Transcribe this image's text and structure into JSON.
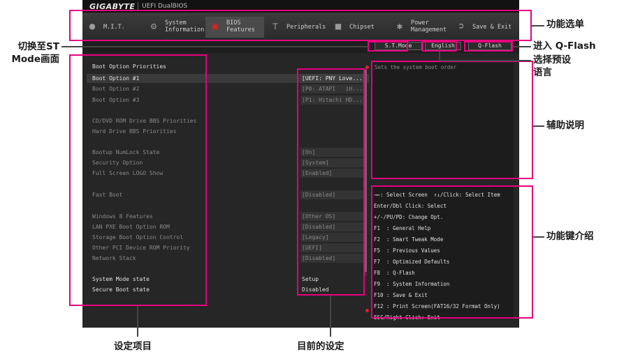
{
  "brand": "GIGABYTE",
  "product": "UEFI DualBIOS",
  "menu": [
    {
      "label": "M.I.T.",
      "icon": "disc-icon"
    },
    {
      "label": "System\nInformation",
      "icon": "gear-icon"
    },
    {
      "label": "BIOS\nFeatures",
      "icon": "bios-chip-icon"
    },
    {
      "label": "Peripherals",
      "icon": "peripherals-icon"
    },
    {
      "label": "Chipset",
      "icon": "chipset-icon"
    },
    {
      "label": "Power\nManagement",
      "icon": "power-icon"
    },
    {
      "label": "Save & Exit",
      "icon": "exit-icon"
    }
  ],
  "buttons": {
    "st_mode": "S.T.Mode",
    "language": "English",
    "qflash": "Q-Flash"
  },
  "settings": [
    {
      "label": "Boot Option Priorities",
      "value": ""
    },
    {
      "label": "Boot Option #1",
      "value": "[UEFI: PNY Love...]"
    },
    {
      "label": "Boot Option #2",
      "value": "[P0: ATAPI   iH...]"
    },
    {
      "label": "Boot Option #3",
      "value": "[P1: Hitachi HD...]"
    },
    {
      "label": "CD/DVD ROM Drive BBS Priorities",
      "value": ""
    },
    {
      "label": "Hard Drive BBS Priorities",
      "value": ""
    },
    {
      "label": "Bootup NumLock State",
      "value": "[On]"
    },
    {
      "label": "Security Option",
      "value": "[System]"
    },
    {
      "label": "Full Screen LOGO Show",
      "value": "[Enabled]"
    },
    {
      "label": "Fast Boot",
      "value": "[Disabled]"
    },
    {
      "label": "Windows 8 Features",
      "value": "[Other OS]"
    },
    {
      "label": "LAN PXE Boot Option ROM",
      "value": "[Disabled]"
    },
    {
      "label": "Storage Boot Option Control",
      "value": "[Legacy]"
    },
    {
      "label": "Other PCI Device ROM Priority",
      "value": "[UEFI]"
    },
    {
      "label": "Network Stack",
      "value": "[Disabled]"
    },
    {
      "label": "System Mode state",
      "value": "Setup"
    },
    {
      "label": "Secure Boot state",
      "value": "Disabled"
    }
  ],
  "help_text": "Sets the system boot order",
  "keys": [
    "→←: Select Screen  ↑↓/Click: Select Item",
    "Enter/Dbl Click: Select",
    "+/-/PU/PD: Change Opt.",
    "F1  : General Help",
    "F2  : Smart Tweak Mode",
    "F5  : Previous Values",
    "F7  : Optimized Defaults",
    "F8  : Q-Flash",
    "F9  : System Information",
    "F10 : Save & Exit",
    "F12 : Print Screen(FAT16/32 Format Only)",
    "ESC/Right Click: Exit"
  ],
  "annotations": {
    "function_menu": "功能选单",
    "st_mode_switch": "切换至ST\nMode画面",
    "enter_qflash": "进入 Q-Flash",
    "select_language": "选择预设\n语言",
    "help_info": "辅助说明",
    "function_keys": "功能键介绍",
    "setting_items": "设定项目",
    "current_settings": "目前的设定"
  },
  "colors": {
    "accent": "#e6007e",
    "bios_red": "#e0202a"
  }
}
